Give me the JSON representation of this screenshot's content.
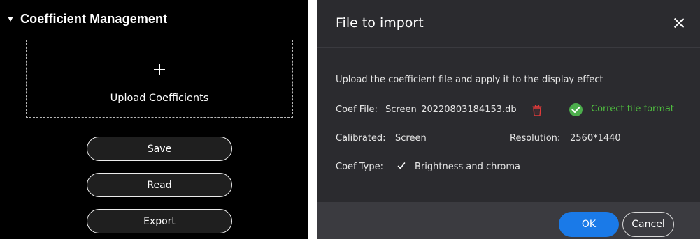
{
  "coefficient_panel": {
    "title": "Coefficient Management",
    "upload_label": "Upload Coefficients",
    "buttons": {
      "save": "Save",
      "read": "Read",
      "export": "Export"
    }
  },
  "dialog": {
    "title": "File to import",
    "description": "Upload the coefficient file and apply it to the display effect",
    "coef_file_label": "Coef File:",
    "coef_file_name": "Screen_20220803184153.db",
    "file_status": "Correct file format",
    "calibrated_label": "Calibrated:",
    "calibrated_value": "Screen",
    "resolution_label": "Resolution:",
    "resolution_value": "2560*1440",
    "coef_type_label": "Coef Type:",
    "coef_type_value": "Brightness and chroma",
    "ok_label": "OK",
    "cancel_label": "Cancel"
  },
  "colors": {
    "panel_bg": "#000000",
    "dialog_bg": "#2b2b2f",
    "primary": "#1a7ae8",
    "success": "#4fbd3f",
    "danger": "#e03a3a"
  },
  "icons": {
    "panel_caret": "caret-down-icon",
    "upload": "plus-icon",
    "delete": "trash-icon",
    "status": "check-circle-icon",
    "coef_type": "check-icon",
    "close": "close-icon"
  }
}
